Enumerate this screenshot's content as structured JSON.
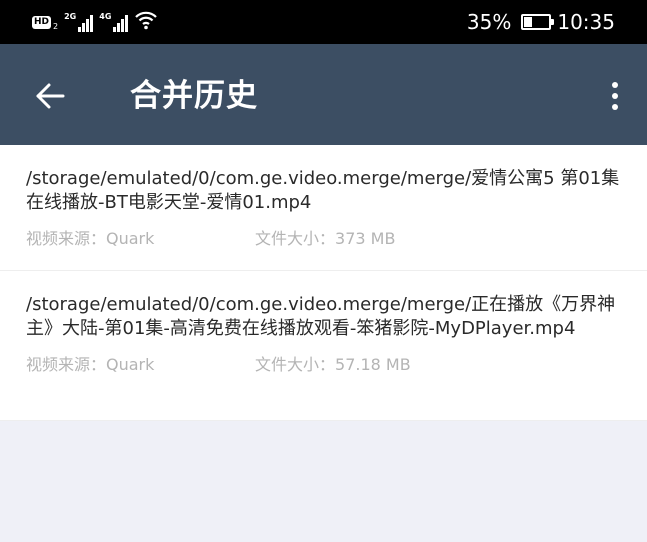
{
  "status_bar": {
    "hd_label": "HD",
    "hd_sub": "2",
    "signal1_label": "2G",
    "signal2_label": "4G",
    "battery_percent_text": "35%",
    "battery_level": 0.35,
    "time": "10:35"
  },
  "header": {
    "title": "合并历史"
  },
  "items": [
    {
      "path": "/storage/emulated/0/com.ge.video.merge/merge/爱情公寓5 第01集在线播放-BT电影天堂-爱情01.mp4",
      "source_label": "视频来源：",
      "source": "Quark",
      "size_label": "文件大小：",
      "size": "373 MB"
    },
    {
      "path": "/storage/emulated/0/com.ge.video.merge/merge/正在播放《万界神主》大陆-第01集-高清免费在线播放观看-笨猪影院-MyDPlayer.mp4",
      "source_label": "视频来源：",
      "source": "Quark",
      "size_label": "文件大小：",
      "size": "57.18 MB"
    }
  ]
}
